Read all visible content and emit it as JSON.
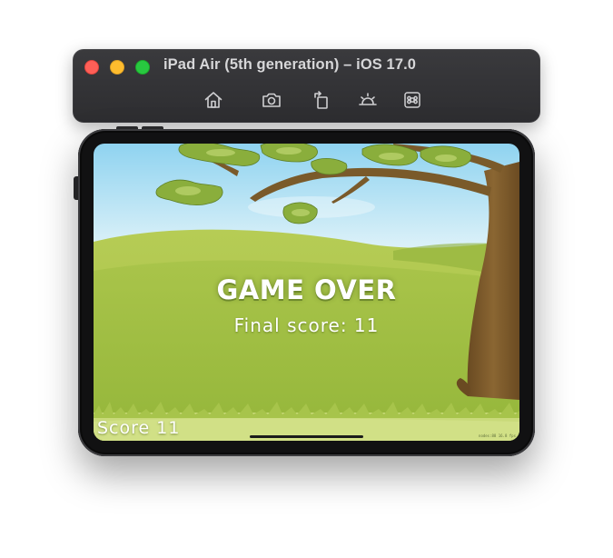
{
  "window": {
    "title": "iPad Air (5th generation) – iOS 17.0",
    "toolbar": [
      {
        "icon": "home-icon"
      },
      {
        "icon": "screenshot-icon"
      },
      {
        "icon": "rotate-icon"
      },
      {
        "icon": "appearance-icon"
      },
      {
        "icon": "command-icon"
      }
    ],
    "traffic_light_colors": {
      "close": "#fe5f57",
      "minimize": "#febc2e",
      "zoom": "#28c840"
    }
  },
  "game": {
    "title": "GAME OVER",
    "final_score": "Final score: 11",
    "score_label": "Score 11",
    "debug_stats": "nodes:88  16.8 fps",
    "colors": {
      "sky": "#bfe6f6",
      "hill": "#9fbd42",
      "trunk": "#7a5a2a",
      "leaves": "#8aae3c"
    }
  }
}
